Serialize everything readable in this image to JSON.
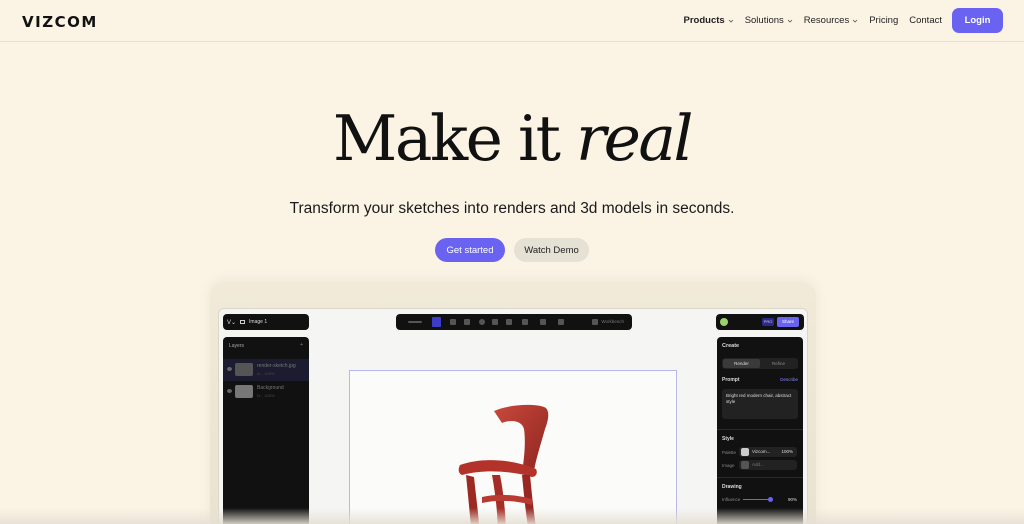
{
  "brand": {
    "logo": "VIZCOM"
  },
  "nav": {
    "items": [
      {
        "label": "Products",
        "has_dropdown": true,
        "bold": true
      },
      {
        "label": "Solutions",
        "has_dropdown": true
      },
      {
        "label": "Resources",
        "has_dropdown": true
      },
      {
        "label": "Pricing",
        "has_dropdown": false
      },
      {
        "label": "Contact",
        "has_dropdown": false
      }
    ],
    "login": "Login"
  },
  "hero": {
    "title_plain": "Make it ",
    "title_italic": "real",
    "subtitle": "Transform your sketches into renders and 3d models in seconds.",
    "primary_button": "Get started",
    "secondary_button": "Watch Demo"
  },
  "app": {
    "file_name": "Image 1",
    "toolbar_mode": "Workbench",
    "pro_badge": "PRO",
    "share": "Share",
    "layers_panel": {
      "title": "Layers",
      "layers": [
        {
          "name": "render-sketch.jpg",
          "meta": "N... 100%"
        },
        {
          "name": "Background",
          "meta": "N... 100%"
        }
      ]
    },
    "create_panel": {
      "title": "Create",
      "tabs": [
        "Render",
        "Refine"
      ],
      "prompt_label": "Prompt",
      "describe": "Describe",
      "prompt_text": "Bright red modern chair, abstract style",
      "style_label": "Style",
      "palette_label": "Palette",
      "palette_value": "Vizcom...",
      "palette_pct": "100%",
      "image_label": "Image",
      "image_value": "Add...",
      "drawing_label": "Drawing",
      "influence_label": "Influence",
      "influence_value": "90%",
      "influence_fraction": 0.9
    }
  },
  "colors": {
    "accent": "#6a63f2",
    "background": "#fbf4e5",
    "chair": "#b3332b"
  }
}
